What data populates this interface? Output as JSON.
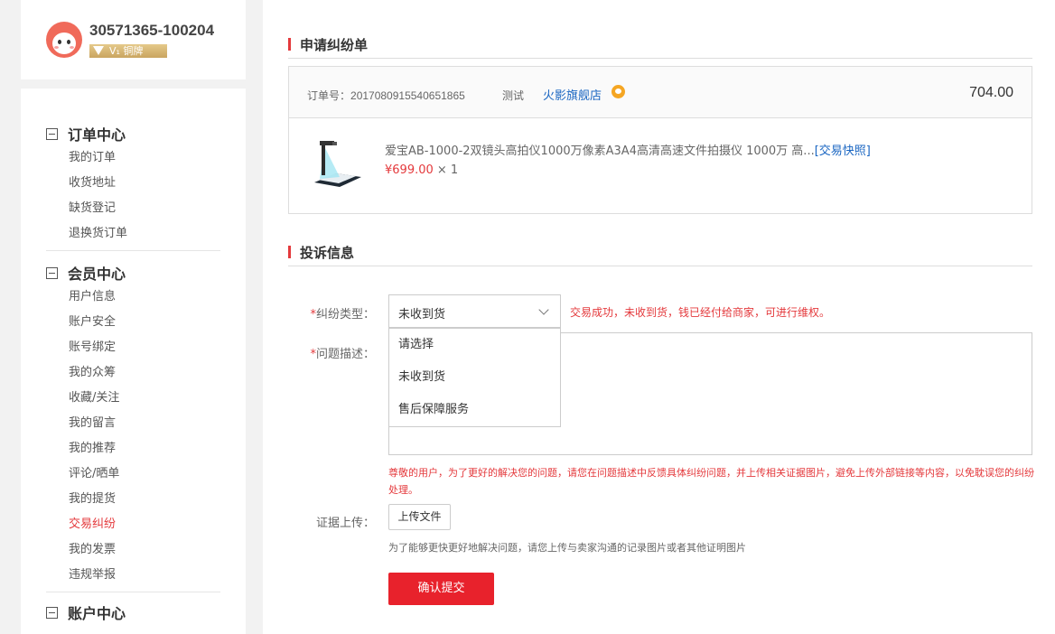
{
  "user": {
    "id": "30571365-100204",
    "level_badge": "V₁ 铜牌"
  },
  "sidebar": {
    "sections": [
      {
        "title": "订单中心",
        "items": [
          "我的订单",
          "收货地址",
          "缺货登记",
          "退换货订单"
        ]
      },
      {
        "title": "会员中心",
        "items": [
          "用户信息",
          "账户安全",
          "账号绑定",
          "我的众筹",
          "收藏/关注",
          "我的留言",
          "我的推荐",
          "评论/晒单",
          "我的提货",
          "交易纠纷",
          "我的发票",
          "违规举报"
        ]
      },
      {
        "title": "账户中心",
        "items": []
      }
    ],
    "active_item": "交易纠纷"
  },
  "dispute": {
    "title": "申请纠纷单",
    "order_no_label": "订单号：",
    "order_no": "2017080915540651865",
    "seller": "测试",
    "shop": "火影旗舰店",
    "total": "704.00",
    "product_title": "爱宝AB-1000-2双镜头高拍仪1000万像素A3A4高清高速文件拍摄仪 1000万 高...",
    "snapshot_link": "[交易快照]",
    "price": "¥699.00",
    "qty": " × 1"
  },
  "complaint": {
    "title": "投诉信息",
    "type_label": "纠纷类型：",
    "type_value": "未收到货",
    "type_hint": "交易成功，未收到货，钱已经付给商家，可进行维权。",
    "options": [
      "请选择",
      "未收到货",
      "售后保障服务"
    ],
    "desc_label": "问题描述：",
    "notice": "尊敬的用户，为了更好的解决您的问题，请您在问题描述中反馈具体纠纷问题，并上传相关证据图片，避免上传外部链接等内容，以免耽误您的纠纷处理。",
    "upload_label": "证据上传：",
    "upload_button": "上传文件",
    "upload_tip": "为了能够更快更好地解决问题，请您上传与卖家沟通的记录图片或者其他证明图片",
    "submit_button": "确认提交"
  },
  "colors": {
    "accent": "#e4393c",
    "link": "#1a66c2",
    "submit": "#e8222c"
  }
}
